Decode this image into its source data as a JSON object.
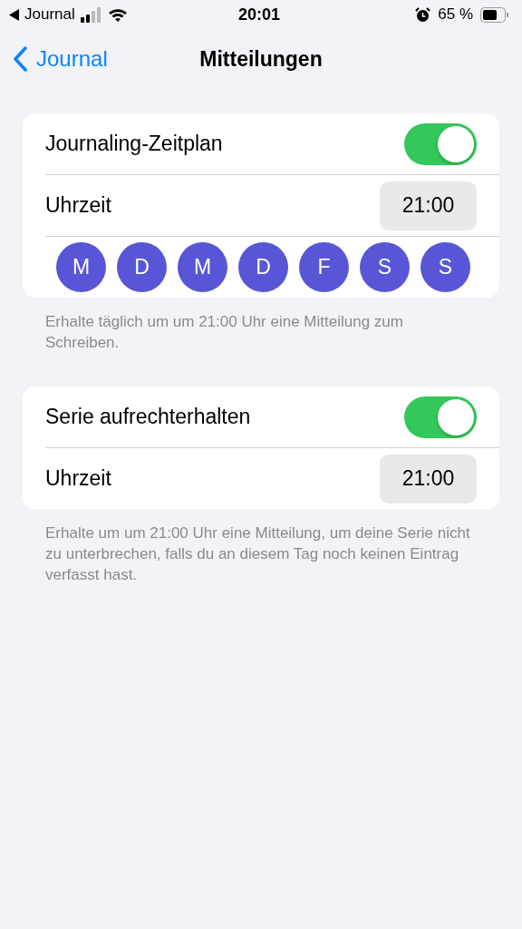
{
  "status_bar": {
    "back_app": "Journal",
    "time": "20:01",
    "battery": "65 %",
    "alarm": true
  },
  "nav": {
    "back": "Journal",
    "title": "Mitteilungen"
  },
  "sections": [
    {
      "toggle": {
        "label": "Journaling-Zeitplan",
        "on": true
      },
      "time": {
        "label": "Uhrzeit",
        "value": "21:00"
      },
      "days": [
        {
          "label": "M",
          "selected": true
        },
        {
          "label": "D",
          "selected": true
        },
        {
          "label": "M",
          "selected": true
        },
        {
          "label": "D",
          "selected": true
        },
        {
          "label": "F",
          "selected": true
        },
        {
          "label": "S",
          "selected": true
        },
        {
          "label": "S",
          "selected": true
        }
      ],
      "footer": "Erhalte täglich um um 21:00 Uhr eine Mitteilung zum Schreiben."
    },
    {
      "toggle": {
        "label": "Serie aufrechterhalten",
        "on": true
      },
      "time": {
        "label": "Uhrzeit",
        "value": "21:00"
      },
      "footer": "Erhalte um um 21:00 Uhr eine Mitteilung, um deine Serie nicht zu unterbrechen, falls du an diesem Tag noch keinen Eintrag verfasst hast."
    }
  ]
}
